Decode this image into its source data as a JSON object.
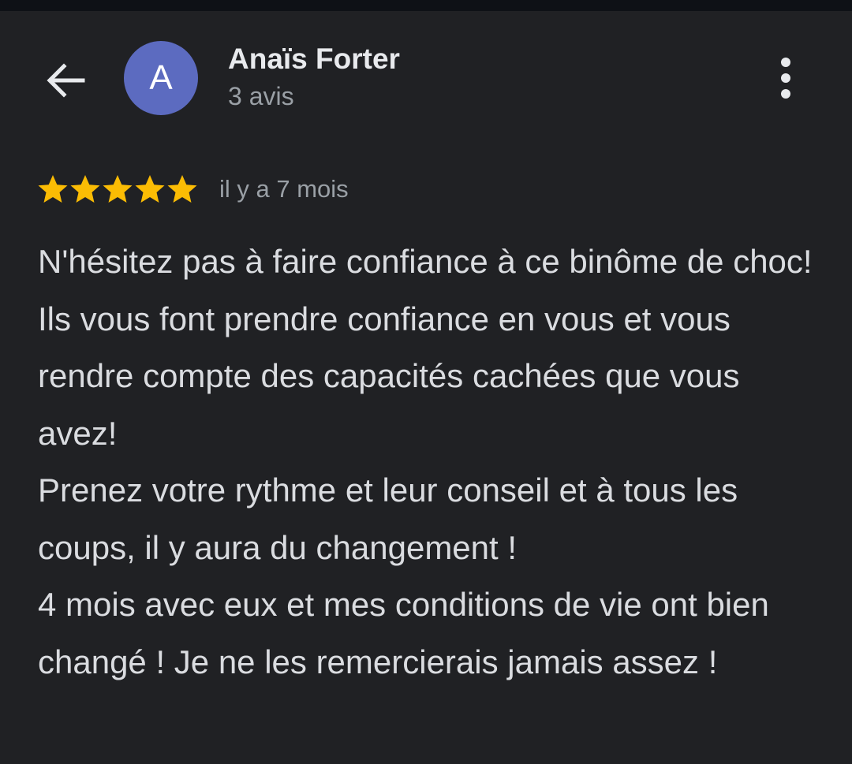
{
  "header": {
    "back_icon": "arrow-left-icon",
    "avatar_letter": "A",
    "avatar_color": "#5c6bc0",
    "name": "Anaïs Forter",
    "review_count": "3 avis",
    "more_icon": "more-vertical-icon"
  },
  "review": {
    "rating": 5,
    "rating_max": 5,
    "star_color": "#fbbc04",
    "timestamp": "il y a 7 mois",
    "paragraphs": [
      "N'hésitez pas à faire confiance à ce binôme de choc! Ils vous font prendre confiance en vous et vous rendre compte des capacités cachées que vous avez!",
      "Prenez votre rythme et leur conseil et à tous les coups, il y aura du changement !",
      "4 mois avec eux et mes conditions de vie ont bien changé ! Je ne les remercierais jamais assez !"
    ]
  },
  "colors": {
    "background": "#202124",
    "primary_text": "#e8eaed",
    "secondary_text": "#9aa0a6"
  }
}
